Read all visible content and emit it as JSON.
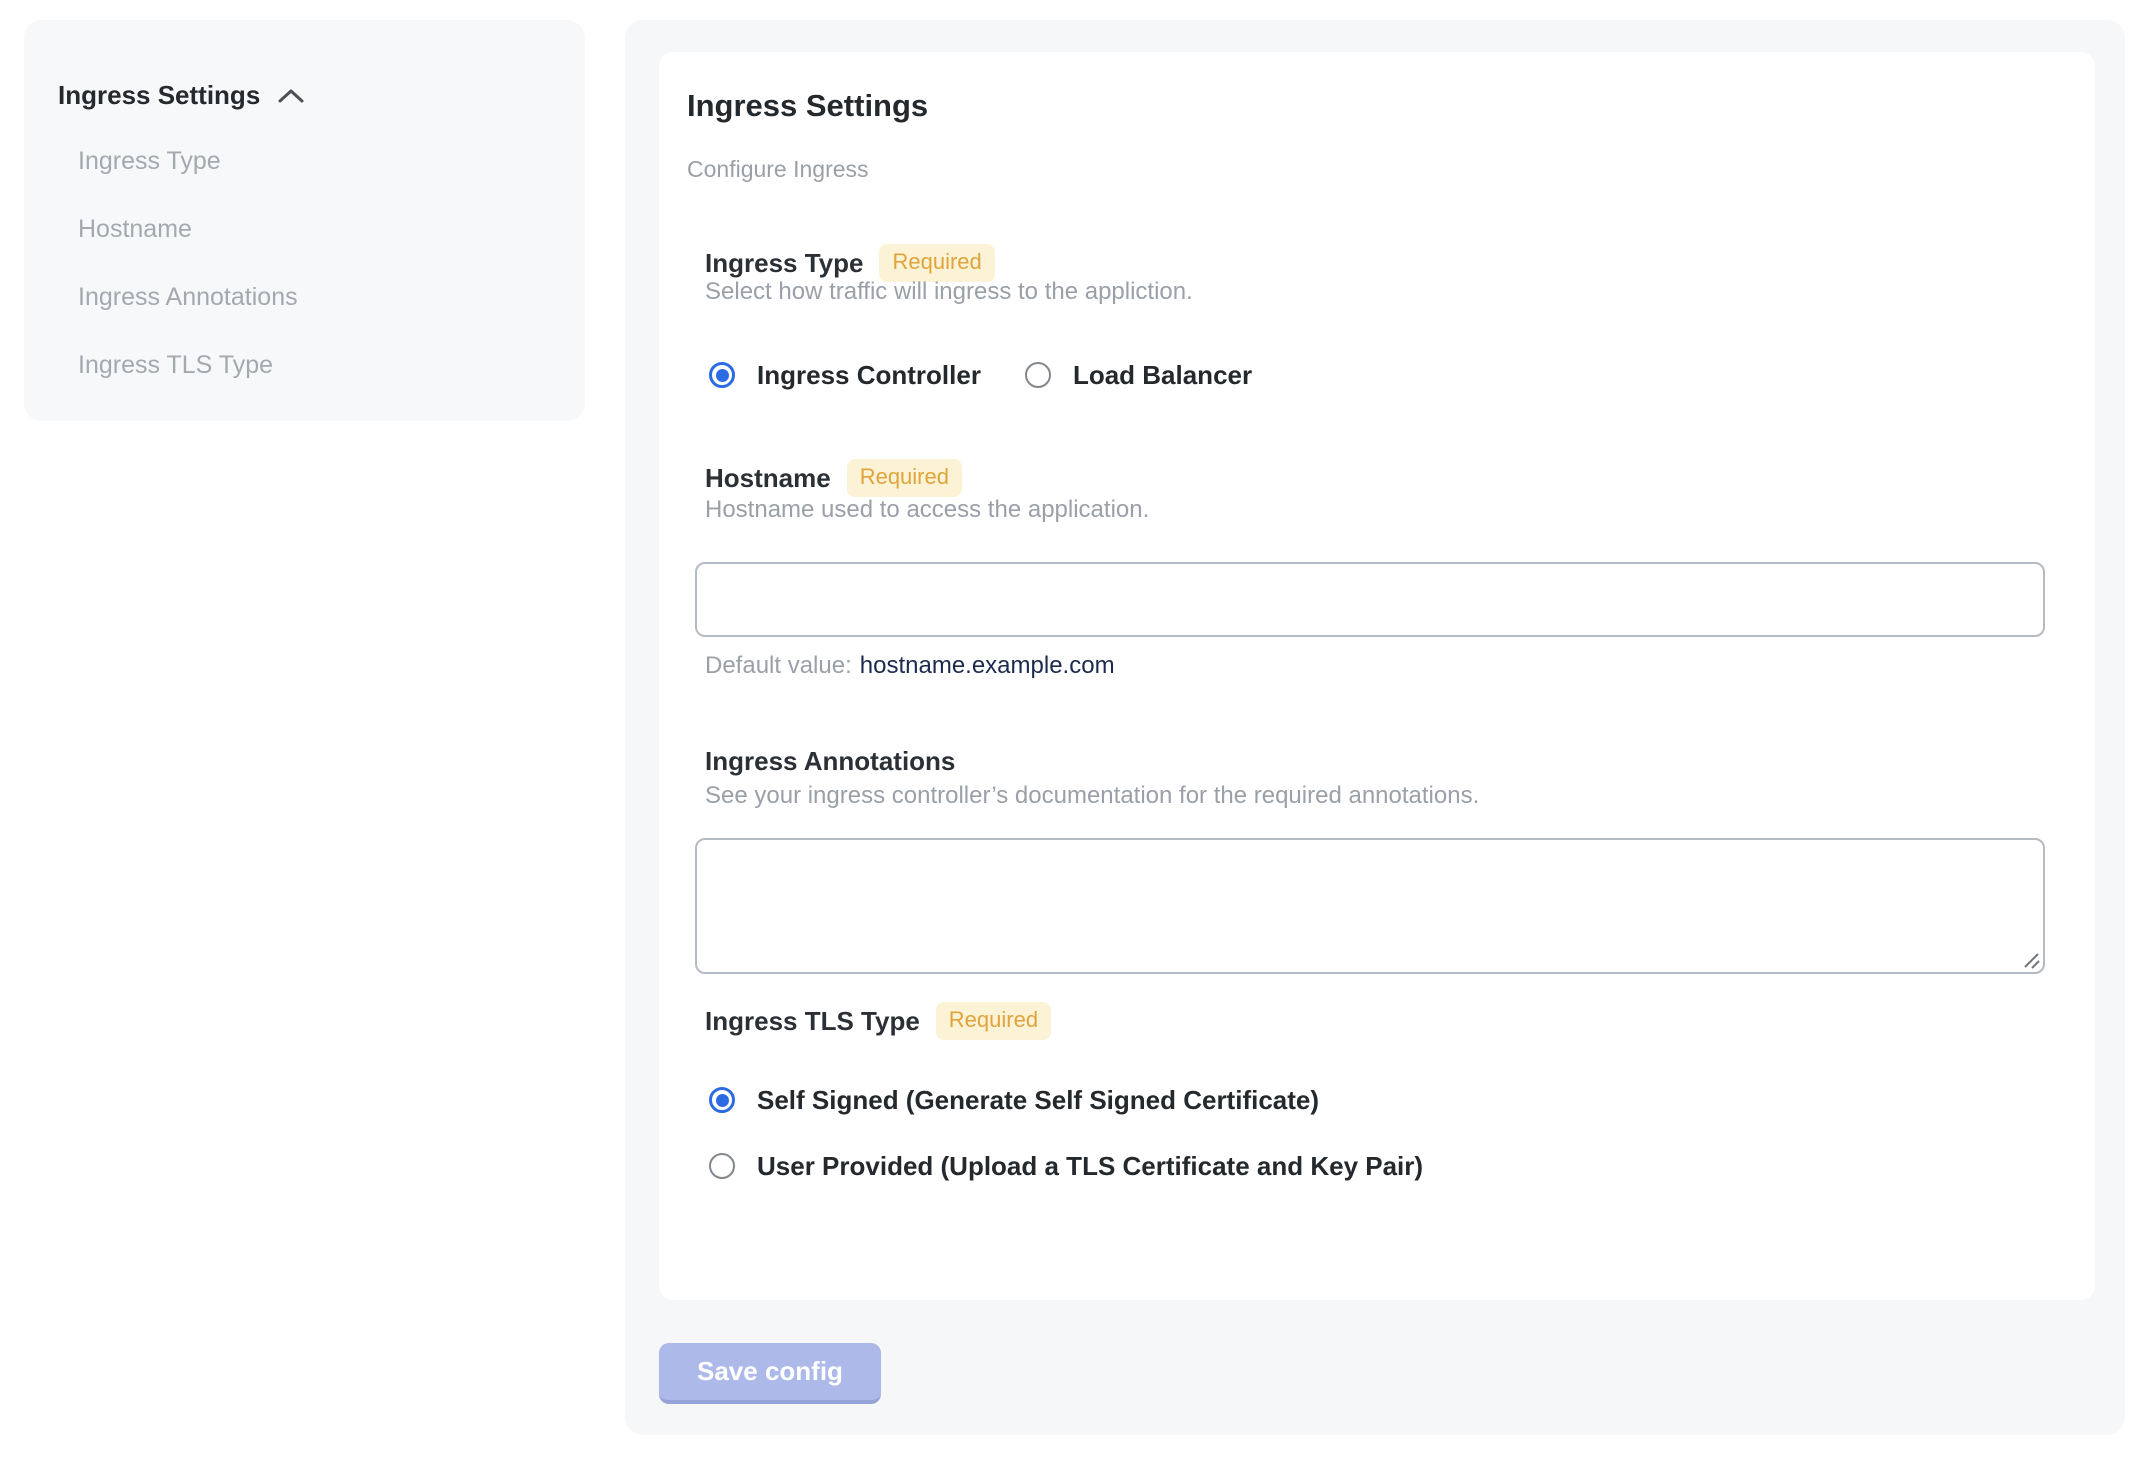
{
  "sidebar": {
    "title": "Ingress Settings",
    "collapse_icon": "chevron-up-icon",
    "items": [
      {
        "label": "Ingress Type"
      },
      {
        "label": "Hostname"
      },
      {
        "label": "Ingress Annotations"
      },
      {
        "label": "Ingress TLS Type"
      }
    ]
  },
  "main": {
    "title": "Ingress Settings",
    "subtitle": "Configure Ingress",
    "fields": {
      "ingress_type": {
        "label": "Ingress Type",
        "required_badge": "Required",
        "help": "Select how traffic will ingress to the appliction.",
        "options": [
          {
            "label": "Ingress Controller",
            "selected": true
          },
          {
            "label": "Load Balancer",
            "selected": false
          }
        ]
      },
      "hostname": {
        "label": "Hostname",
        "required_badge": "Required",
        "help": "Hostname used to access the application.",
        "value": "",
        "default_prefix": "Default value:",
        "default_value": "hostname.example.com"
      },
      "annotations": {
        "label": "Ingress Annotations",
        "help": "See your ingress controller’s documentation for the required annotations.",
        "value": ""
      },
      "tls_type": {
        "label": "Ingress TLS Type",
        "required_badge": "Required",
        "options": [
          {
            "label": "Self Signed (Generate Self Signed Certificate)",
            "selected": true
          },
          {
            "label": "User Provided (Upload a TLS Certificate and Key Pair)",
            "selected": false
          }
        ]
      }
    },
    "save_button": "Save config"
  },
  "colors": {
    "accent_blue": "#2d6be4",
    "badge_bg": "#fcf2d5",
    "badge_text": "#dfa43c",
    "panel_bg": "#f6f7f9",
    "sidebar_bg": "#f7f8fa",
    "muted_text": "#9aa0a7",
    "dark_text": "#24292e",
    "default_value_text": "#1b2b4e",
    "save_button_bg": "#acb9e9",
    "save_button_edge": "#96a3d6"
  }
}
